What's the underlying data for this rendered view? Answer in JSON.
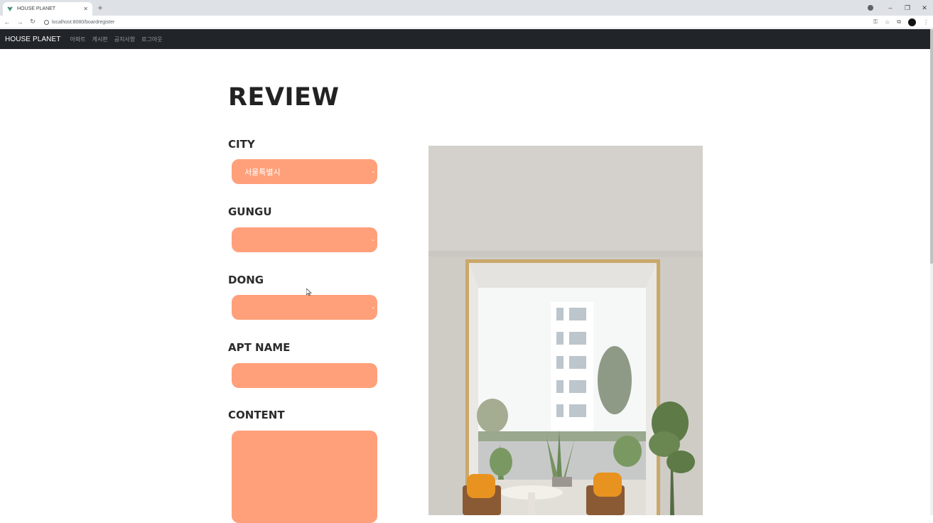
{
  "browser": {
    "tab_title": "HOUSE PLANET",
    "url": "localhost:8080/boardregister"
  },
  "nav": {
    "brand": "HOUSE PLANET",
    "links": [
      "아파트",
      "게시판",
      "공지사항",
      "로그아웃"
    ]
  },
  "page": {
    "title": "REVIEW"
  },
  "form": {
    "city_label": "CITY",
    "city_value": "서울특별시",
    "gungu_label": "GUNGU",
    "gungu_value": "",
    "dong_label": "DONG",
    "dong_value": "",
    "apt_label": "APT NAME",
    "apt_value": "",
    "content_label": "CONTENT",
    "content_value": ""
  },
  "colors": {
    "field_bg": "#ffa07a",
    "navbar_bg": "#212529"
  },
  "icons": [
    "vue-favicon-icon",
    "close-icon",
    "plus-icon",
    "back-arrow-icon",
    "forward-arrow-icon",
    "reload-icon",
    "info-icon",
    "key-icon",
    "star-icon",
    "extensions-icon",
    "chevron-down-icon"
  ]
}
